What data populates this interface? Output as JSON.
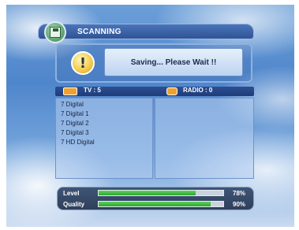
{
  "window": {
    "title": "SCANNING"
  },
  "message": {
    "text": "Saving... Please Wait !!"
  },
  "lists": {
    "tv_label": "TV : 5",
    "radio_label": "RADIO : 0",
    "tv_channels": [
      "7 Digital",
      "7 Digital 1",
      "7 Digital 2",
      "7 Digital 3",
      "7 HD Digital"
    ],
    "radio_channels": []
  },
  "signal": {
    "level": {
      "label": "Level",
      "value_text": "78%",
      "percent": 78
    },
    "quality": {
      "label": "Quality",
      "value_text": "90%",
      "percent": 90
    }
  },
  "icons": {
    "header": "disk-save-icon",
    "warning": "exclamation-icon",
    "tv": "tv-icon",
    "radio": "radio-icon"
  },
  "colors": {
    "accent": "#2f5496",
    "bar_fill": "#3cbf3c",
    "warning": "#f2c94a"
  }
}
